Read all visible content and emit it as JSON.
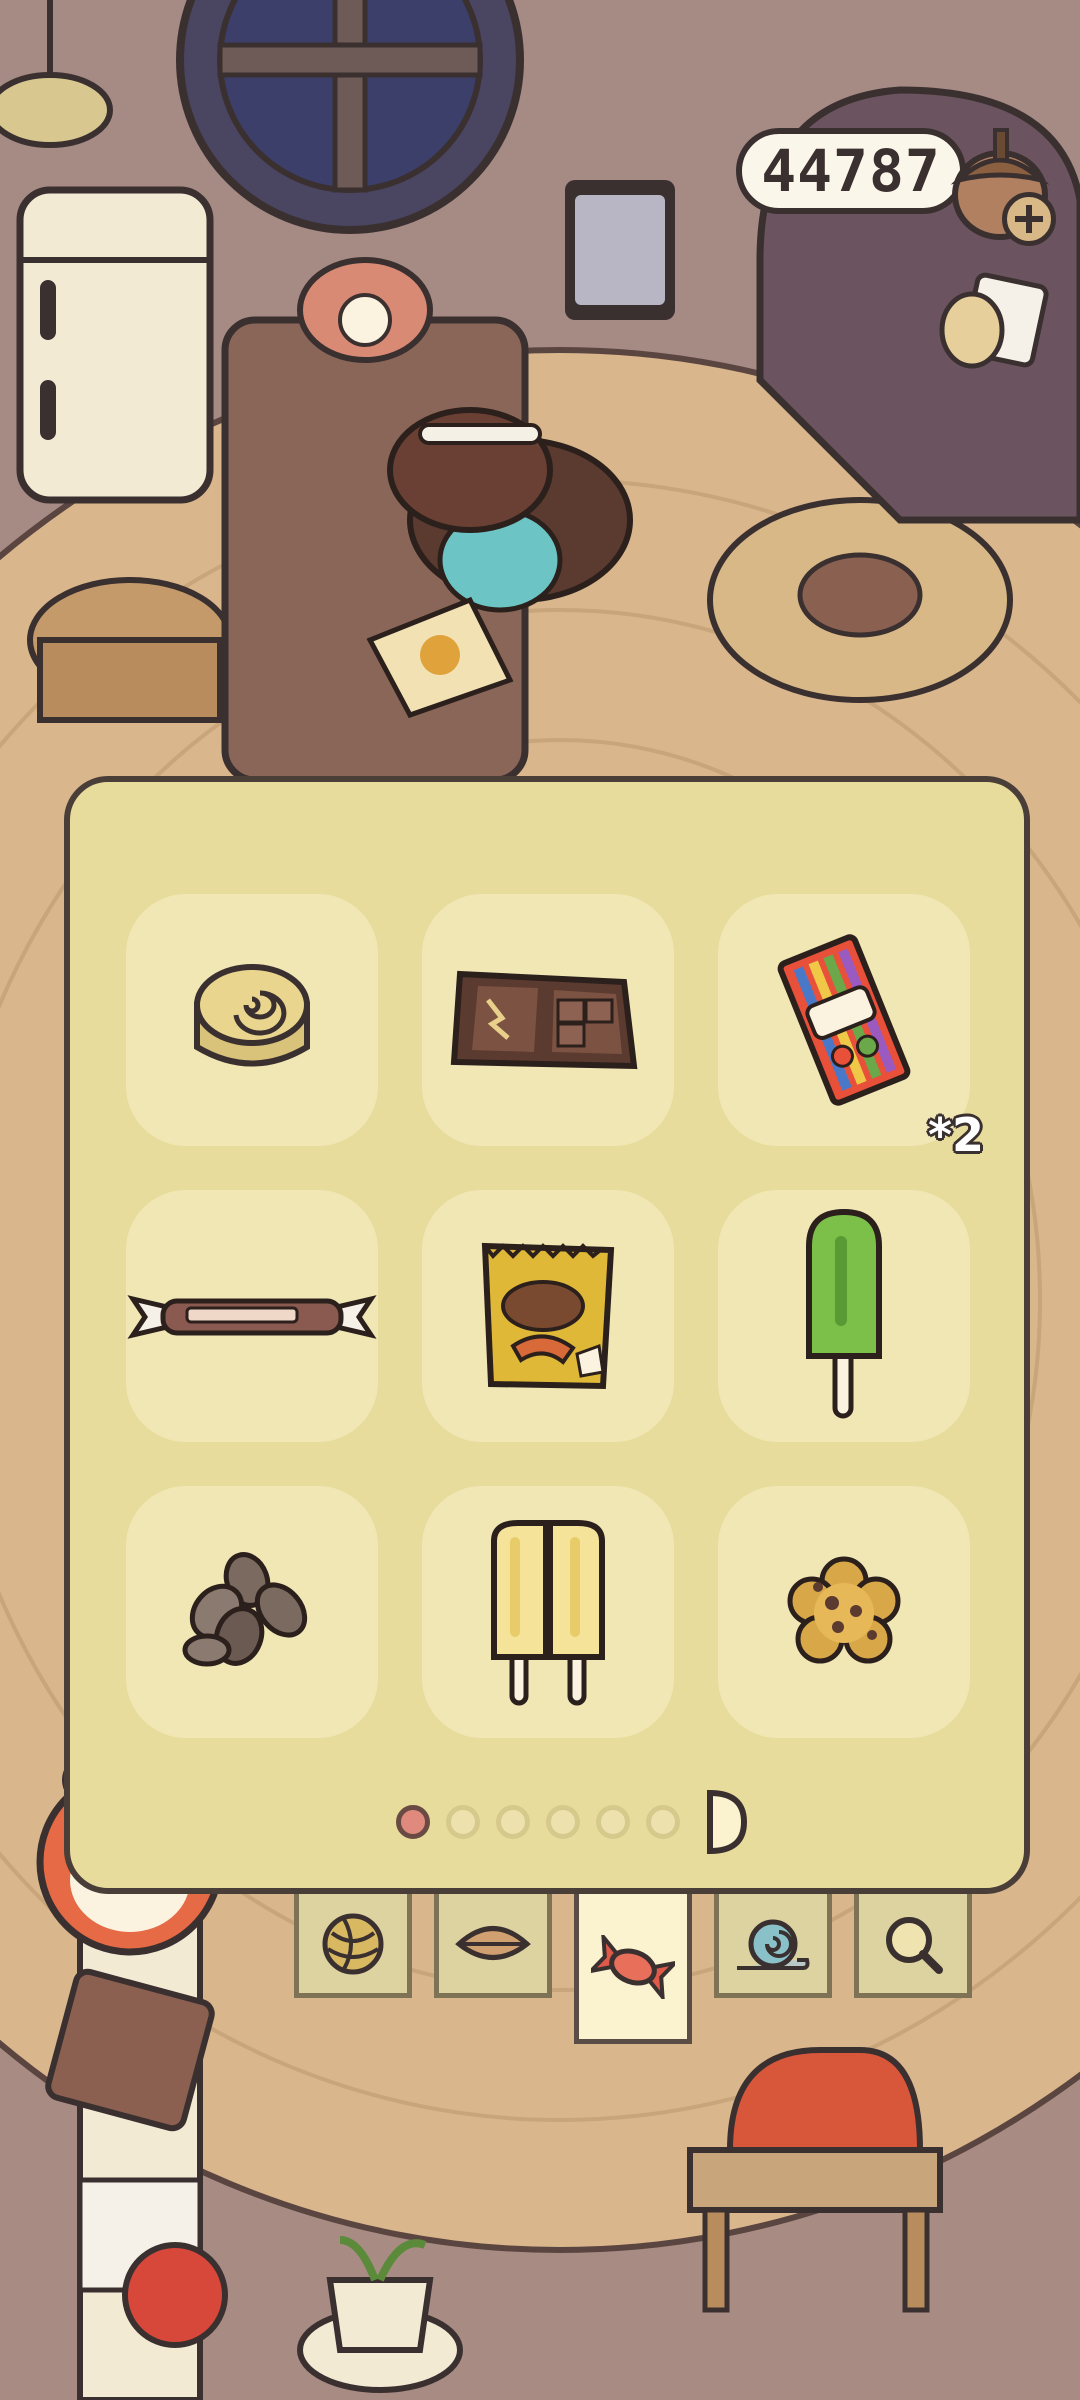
{
  "header": {
    "coins": "44787",
    "icons": [
      "acorn-coin-icon",
      "plus-icon",
      "cat-paw-icon"
    ]
  },
  "snack_inventory": {
    "items": [
      {
        "name": "cinnamon-roll",
        "count": ""
      },
      {
        "name": "chocolate-bar",
        "count": ""
      },
      {
        "name": "candy-pack",
        "count": "*2"
      },
      {
        "name": "wrapped-candy-stick",
        "count": ""
      },
      {
        "name": "snack-chips-bag",
        "count": ""
      },
      {
        "name": "green-popsicle",
        "count": ""
      },
      {
        "name": "sunflower-seeds",
        "count": ""
      },
      {
        "name": "twin-popsicle",
        "count": ""
      },
      {
        "name": "flower-cookie",
        "count": ""
      }
    ],
    "page_index": 1,
    "page_count": 6
  },
  "category_tabs": [
    {
      "name": "yarn-ball-icon",
      "active": false
    },
    {
      "name": "leaf-icon",
      "active": false
    },
    {
      "name": "candy-icon",
      "active": true
    },
    {
      "name": "snail-icon",
      "active": false
    },
    {
      "name": "magnifier-icon",
      "active": false
    }
  ],
  "colors": {
    "panel": "#e8dc9d",
    "slot": "#f0e7b5",
    "outline": "#3b3030",
    "active_dot": "#e08a7e"
  }
}
